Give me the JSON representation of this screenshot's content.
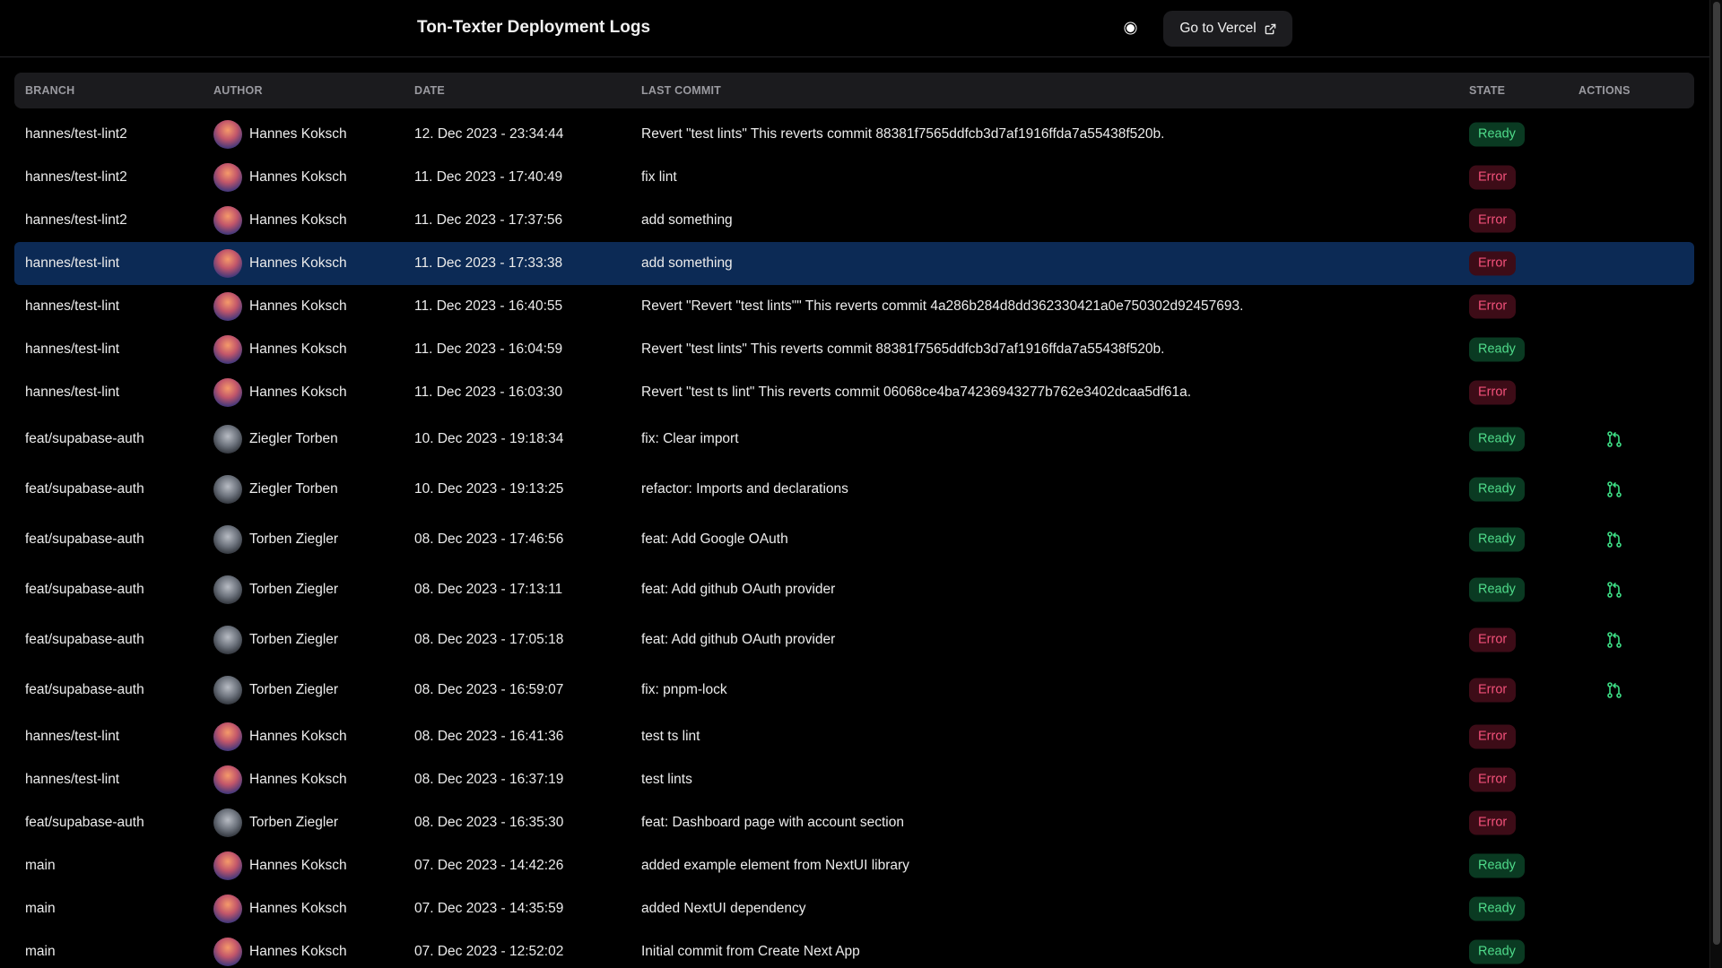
{
  "header": {
    "title": "Ton-Texter Deployment Logs",
    "vercel_button": "Go to Vercel"
  },
  "table": {
    "columns": [
      "BRANCH",
      "AUTHOR",
      "DATE",
      "LAST COMMIT",
      "STATE",
      "ACTIONS"
    ],
    "rows": [
      {
        "branch": "hannes/test-lint2",
        "author": "Hannes Koksch",
        "date": "12. Dec 2023 - 23:34:44",
        "commit": "Revert \"test lints\" This reverts commit 88381f7565ddfcb3d7af1916ffda7a55438f520b.",
        "state": "Ready"
      },
      {
        "branch": "hannes/test-lint2",
        "author": "Hannes Koksch",
        "date": "11. Dec 2023 - 17:40:49",
        "commit": "fix lint",
        "state": "Error"
      },
      {
        "branch": "hannes/test-lint2",
        "author": "Hannes Koksch",
        "date": "11. Dec 2023 - 17:37:56",
        "commit": "add something",
        "state": "Error"
      },
      {
        "branch": "hannes/test-lint",
        "author": "Hannes Koksch",
        "date": "11. Dec 2023 - 17:33:38",
        "commit": "add something",
        "state": "Error",
        "selected": true
      },
      {
        "branch": "hannes/test-lint",
        "author": "Hannes Koksch",
        "date": "11. Dec 2023 - 16:40:55",
        "commit": "Revert \"Revert \"test lints\"\" This reverts commit 4a286b284d8dd362330421a0e750302d92457693.",
        "state": "Error"
      },
      {
        "branch": "hannes/test-lint",
        "author": "Hannes Koksch",
        "date": "11. Dec 2023 - 16:04:59",
        "commit": "Revert \"test lints\" This reverts commit 88381f7565ddfcb3d7af1916ffda7a55438f520b.",
        "state": "Ready"
      },
      {
        "branch": "hannes/test-lint",
        "author": "Hannes Koksch",
        "date": "11. Dec 2023 - 16:03:30",
        "commit": "Revert \"test ts lint\" This reverts commit 06068ce4ba74236943277b762e3402dcaa5df61a.",
        "state": "Error"
      },
      {
        "branch": "feat/supabase-auth",
        "author": "Ziegler Torben",
        "date": "10. Dec 2023 - 19:18:34",
        "commit": "fix: Clear import",
        "state": "Ready",
        "action": "pull-request-icon"
      },
      {
        "branch": "feat/supabase-auth",
        "author": "Ziegler Torben",
        "date": "10. Dec 2023 - 19:13:25",
        "commit": "refactor: Imports and declarations",
        "state": "Ready",
        "action": "pull-request-icon"
      },
      {
        "branch": "feat/supabase-auth",
        "author": "Torben Ziegler",
        "date": "08. Dec 2023 - 17:46:56",
        "commit": "feat: Add Google OAuth",
        "state": "Ready",
        "action": "pull-request-icon"
      },
      {
        "branch": "feat/supabase-auth",
        "author": "Torben Ziegler",
        "date": "08. Dec 2023 - 17:13:11",
        "commit": "feat: Add github OAuth provider",
        "state": "Ready",
        "action": "pull-request-icon"
      },
      {
        "branch": "feat/supabase-auth",
        "author": "Torben Ziegler",
        "date": "08. Dec 2023 - 17:05:18",
        "commit": "feat: Add github OAuth provider",
        "state": "Error",
        "action": "pull-request-icon"
      },
      {
        "branch": "feat/supabase-auth",
        "author": "Torben Ziegler",
        "date": "08. Dec 2023 - 16:59:07",
        "commit": "fix: pnpm-lock",
        "state": "Error",
        "action": "pull-request-icon"
      },
      {
        "branch": "hannes/test-lint",
        "author": "Hannes Koksch",
        "date": "08. Dec 2023 - 16:41:36",
        "commit": "test ts lint",
        "state": "Error"
      },
      {
        "branch": "hannes/test-lint",
        "author": "Hannes Koksch",
        "date": "08. Dec 2023 - 16:37:19",
        "commit": "test lints",
        "state": "Error"
      },
      {
        "branch": "feat/supabase-auth",
        "author": "Torben Ziegler",
        "date": "08. Dec 2023 - 16:35:30",
        "commit": "feat: Dashboard page with account section",
        "state": "Error"
      },
      {
        "branch": "main",
        "author": "Hannes Koksch",
        "date": "07. Dec 2023 - 14:42:26",
        "commit": "added example element from NextUI library",
        "state": "Ready"
      },
      {
        "branch": "main",
        "author": "Hannes Koksch",
        "date": "07. Dec 2023 - 14:35:59",
        "commit": "added NextUI dependency",
        "state": "Ready"
      },
      {
        "branch": "main",
        "author": "Hannes Koksch",
        "date": "07. Dec 2023 - 12:52:02",
        "commit": "Initial commit from Create Next App",
        "state": "Ready"
      }
    ]
  },
  "colors": {
    "background": "#000000",
    "selected_row": "#0c2a55",
    "ready": "#4fdb8a",
    "error": "#f2517a",
    "action_icon": "#3ddc84"
  },
  "icons": {
    "theme_toggle": "sun-icon",
    "vercel_button": "external-link-icon"
  }
}
